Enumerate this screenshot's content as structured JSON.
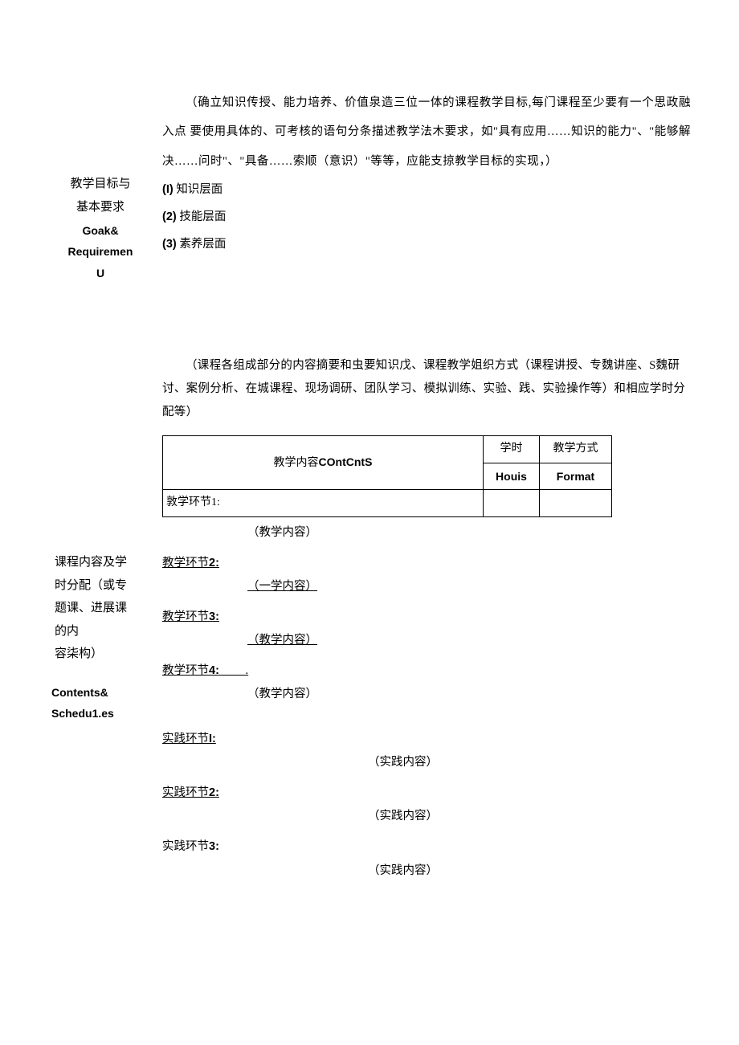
{
  "section1": {
    "intro": "（确立知识传授、能力培养、价值泉造三位一体的课程教学目标,每门课程至少要有一个思政融入点 要使用具体的、可考核的语句分条描述教学法木要求，如\"具有应用……知识的能力\"、\"能够解决……问时\"、\"具备……索顺（意识）\"等等，应能支掠教学目标的实现，）",
    "label_zh_1": "教学目标与",
    "label_zh_2": "基本要求",
    "label_en_1": "Goak&",
    "label_en_2": "Requiremen",
    "label_en_3": "U",
    "lv1_num": "(I)",
    "lv1_txt": " 知识层面",
    "lv2_num": "(2)",
    "lv2_txt": " 技能层面",
    "lv3_num": "(3)",
    "lv3_txt": " 素养层面"
  },
  "section2": {
    "desc": "（课程各组成部分的内容摘要和虫要知识戊、课程教学姐织方式（课程讲授、专魏讲座、S魏研讨、案例分析、在城课程、现场调研、团队学习、模拟训练、实验、践、实验操作等）和相应学时分配等）",
    "table": {
      "col_content_zh": "教学内容",
      "col_content_en": "COntCntS",
      "col_hours_zh": "学时",
      "col_hours_en": "Houis",
      "col_format_zh": "教学方式",
      "col_format_en": "Format",
      "row1": "敦学环节1:"
    },
    "label_zh_line1": "课程内容及学",
    "label_zh_line2": "时分配（或专",
    "label_zh_line3": "题课、进展课",
    "label_zh_line4": "的内",
    "label_zh_line5": "容柒构）",
    "label_en_1": "Contents&",
    "label_en_2": "Schedu1.es",
    "tseg1_note": "（教学内容）",
    "tseg2_title_pre": "教学环节",
    "tseg2_num": "2:",
    "tseg2_note": "（一学内容）",
    "tseg3_title_pre": "教学环节",
    "tseg3_num": "3:",
    "tseg3_note": "（教学内容）",
    "tseg4_title_pre": "教学环节",
    "tseg4_num": "4:",
    "tseg4_dot": "         .",
    "tseg4_note": "（教学内容）",
    "pseg1_title_pre": "实践环节",
    "pseg1_num": "I:",
    "pseg1_note": "（实践内容）",
    "pseg2_title_pre": "实践环节",
    "pseg2_num": "2:",
    "pseg2_note": "（实践内容）",
    "pseg3_title_pre": "实践环节",
    "pseg3_num": "3:",
    "pseg3_note": "（实践内容）"
  }
}
